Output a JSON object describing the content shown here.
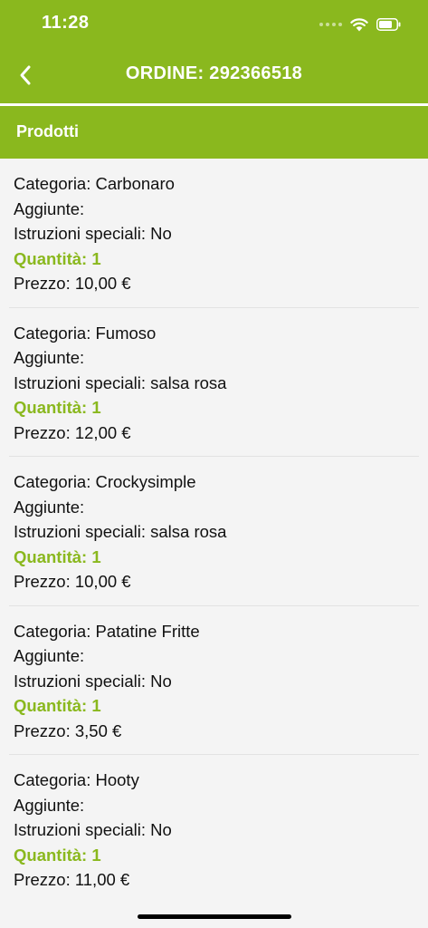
{
  "status_bar": {
    "time": "11:28"
  },
  "nav": {
    "title": "ORDINE: 292366518",
    "back_icon": "chevron-left-icon"
  },
  "section": {
    "title": "Prodotti"
  },
  "colors": {
    "accent": "#8ab81e",
    "background": "#f4f4f4",
    "text": "#111111"
  },
  "products": [
    {
      "category": "Categoria: Carbonaro",
      "additions": "Aggiunte:",
      "instructions": "Istruzioni speciali: No",
      "quantity": "Quantità: 1",
      "price": "Prezzo: 10,00 €"
    },
    {
      "category": "Categoria: Fumoso",
      "additions": "Aggiunte:",
      "instructions": "Istruzioni speciali: salsa rosa",
      "quantity": "Quantità: 1",
      "price": "Prezzo: 12,00 €"
    },
    {
      "category": "Categoria: Crockysimple",
      "additions": "Aggiunte:",
      "instructions": "Istruzioni speciali: salsa rosa",
      "quantity": "Quantità: 1",
      "price": "Prezzo: 10,00 €"
    },
    {
      "category": "Categoria: Patatine Fritte",
      "additions": "Aggiunte:",
      "instructions": "Istruzioni speciali: No",
      "quantity": "Quantità: 1",
      "price": "Prezzo: 3,50 €"
    },
    {
      "category": "Categoria: Hooty",
      "additions": "Aggiunte:",
      "instructions": "Istruzioni speciali: No",
      "quantity": "Quantità: 1",
      "price": "Prezzo: 11,00 €"
    }
  ]
}
